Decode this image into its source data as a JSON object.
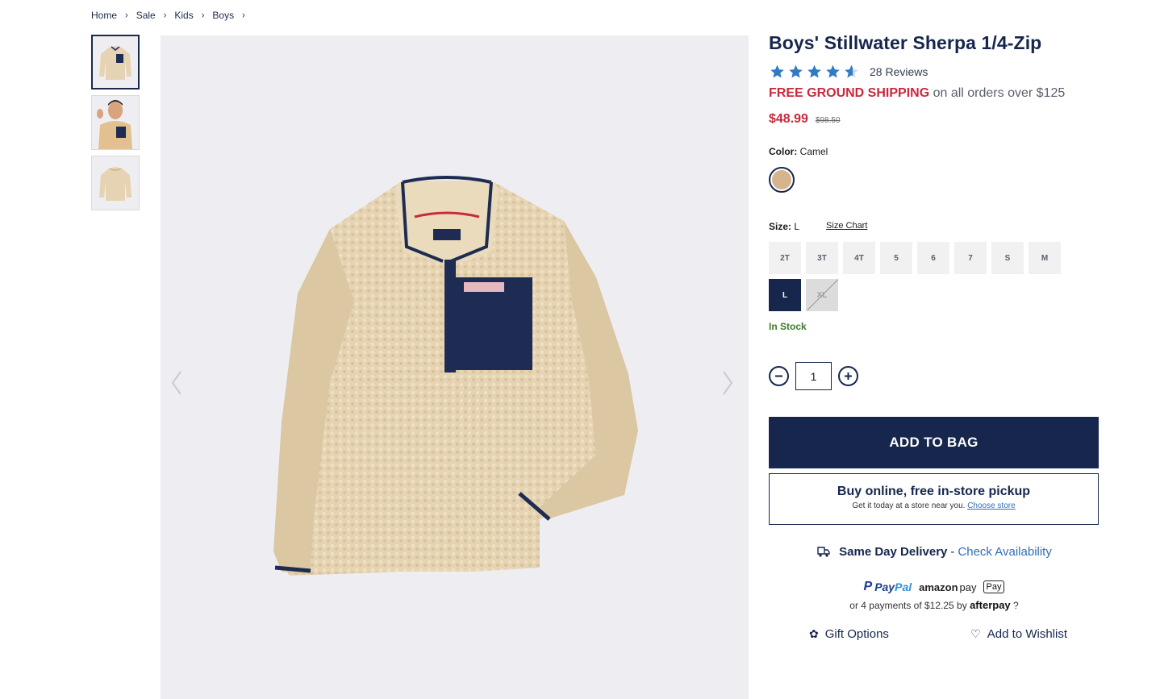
{
  "breadcrumb": [
    "Home",
    "Sale",
    "Kids",
    "Boys"
  ],
  "product": {
    "title": "Boys' Stillwater Sherpa 1/4-Zip",
    "rating": 4.5,
    "reviews": "28 Reviews",
    "shipping_free": "FREE GROUND SHIPPING",
    "shipping_rest": " on all orders over $125",
    "price": "$48.99",
    "old_price": "$98.50"
  },
  "color": {
    "label": "Color:",
    "value": "Camel",
    "swatch": "#d6b48c"
  },
  "size": {
    "label": "Size:",
    "value": "L",
    "chart_link": "Size Chart",
    "options": [
      "2T",
      "3T",
      "4T",
      "5",
      "6",
      "7",
      "S",
      "M",
      "L",
      "XL"
    ],
    "selected": "L",
    "unavailable": [
      "XL"
    ],
    "stock": "In Stock"
  },
  "quantity": {
    "value": "1",
    "minus": "−",
    "plus": "+"
  },
  "actions": {
    "add_to_bag": "ADD TO BAG",
    "pickup_title": "Buy online, free in-store pickup",
    "pickup_sub": "Get it today at a store near you.",
    "choose_store": "Choose store",
    "same_day": "Same Day Delivery",
    "dash": "-",
    "check_availability": "Check Availability"
  },
  "payments": {
    "paypal_p": "P",
    "paypal_pay": "Pay",
    "paypal_pal": "Pal",
    "amazon": "amazon",
    "amazon_pay": "pay",
    "apple": "Pay",
    "afterpay_text": "or 4 payments of $12.25 by",
    "afterpay_logo": "afterpay",
    "afterpay_q": "?"
  },
  "extras": {
    "gift": "Gift Options",
    "wishlist": "Add to Wishlist"
  },
  "colors": {
    "navy": "#16264d",
    "sale_red": "#c8293b",
    "link_blue": "#2f6fb5",
    "stock_green": "#3f7a2d",
    "star_blue": "#2f7bc4"
  },
  "icons": {
    "breadcrumb_sep": "›",
    "heart": "♡",
    "gift": "✿",
    "apple": ""
  }
}
